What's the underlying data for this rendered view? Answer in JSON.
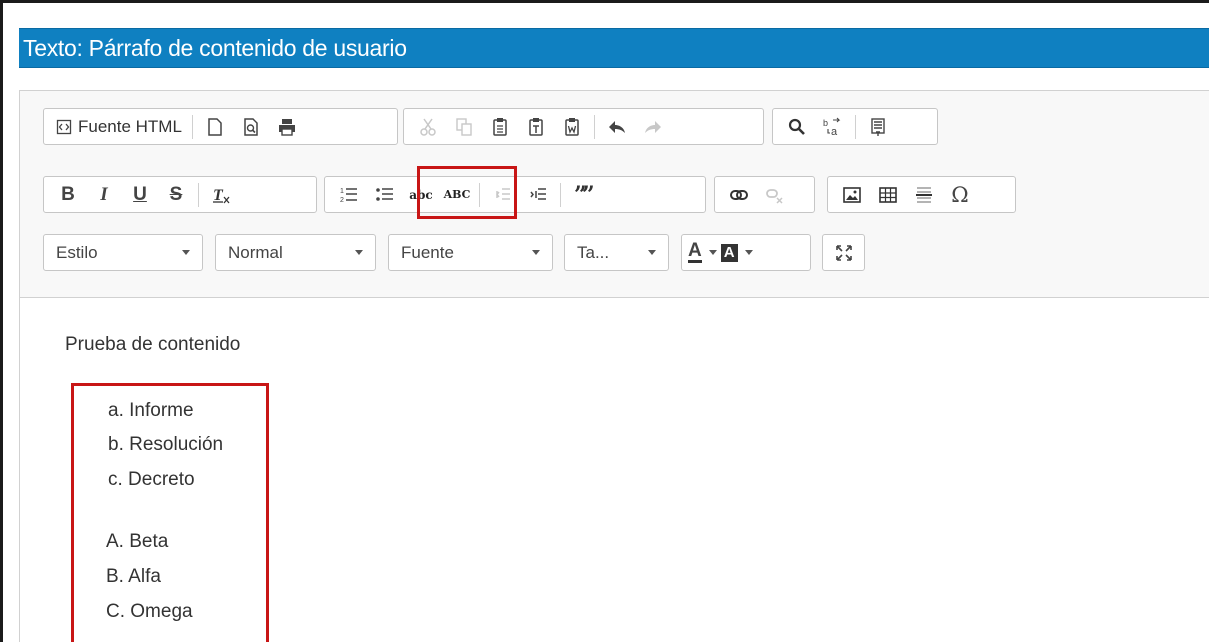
{
  "window": {
    "title": "Texto: Párrafo de contenido de usuario"
  },
  "toolbar": {
    "source_label": "Fuente HTML",
    "style_label": "Estilo",
    "format_label": "Normal",
    "font_label": "Fuente",
    "size_label": "Ta...",
    "bold": "B",
    "italic": "I",
    "underline": "U",
    "strike": "S",
    "lower_alpha": "abc",
    "upper_alpha": "ABC",
    "font_color": "A",
    "bg_color": "A",
    "special_char": "Ω"
  },
  "content": {
    "paragraph": "Prueba de contenido",
    "list_lower": [
      "a. Informe",
      "b. Resolución",
      "c. Decreto"
    ],
    "list_upper": [
      "A. Beta",
      "B. Alfa",
      "C. Omega"
    ]
  },
  "colors": {
    "titlebar": "#0f80c1",
    "highlight": "#c81616"
  }
}
